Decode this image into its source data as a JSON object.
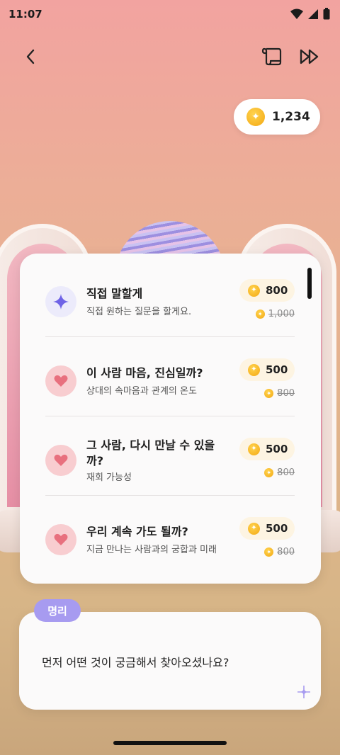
{
  "status": {
    "time": "11:07"
  },
  "nav": {
    "back_icon": "chevron-left-icon",
    "script_icon": "scroll-icon",
    "skip_icon": "fast-forward-icon"
  },
  "wallet": {
    "balance": "1,234"
  },
  "options": [
    {
      "icon": "sparkle-icon",
      "title": "직접 말할게",
      "subtitle": "직접 원하는 질문을 할게요.",
      "price": "800",
      "original_price": "1,000"
    },
    {
      "icon": "heart-icon",
      "title": "이 사람 마음, 진심일까?",
      "subtitle": "상대의 속마음과 관계의 온도",
      "price": "500",
      "original_price": "800"
    },
    {
      "icon": "heart-icon",
      "title": "그 사람, 다시 만날 수 있을까?",
      "subtitle": "재회 가능성",
      "price": "500",
      "original_price": "800"
    },
    {
      "icon": "heart-icon",
      "title": "우리 계속 가도 될까?",
      "subtitle": "지금 만나는 사람과의 궁합과 미래",
      "price": "500",
      "original_price": "800"
    }
  ],
  "chat": {
    "speaker": "명리",
    "message": "먼저 어떤 것이 궁금해서 찾아오셨나요?"
  },
  "colors": {
    "accent_purple": "#a79bf0",
    "heart_pink": "#e8707e",
    "coin_gold": "#f3a812"
  }
}
